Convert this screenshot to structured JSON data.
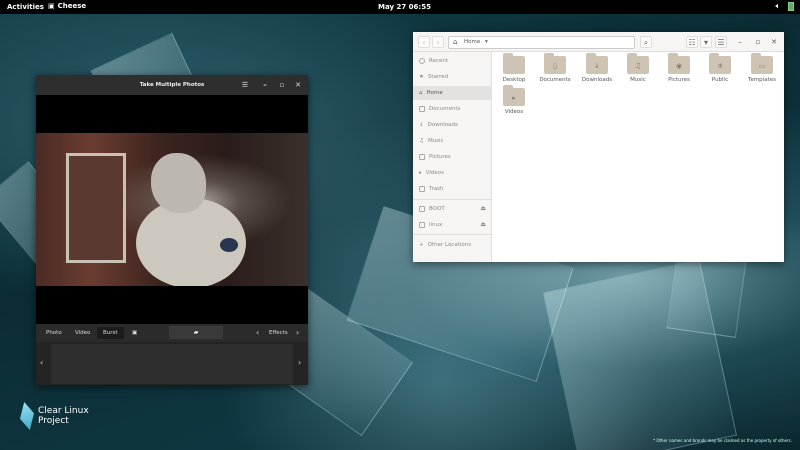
{
  "topbar": {
    "activities": "Activities",
    "app_name": "Cheese",
    "clock": "May 27  06:55"
  },
  "cheese": {
    "title": "Take Multiple Photos",
    "modes": [
      "Photo",
      "Video",
      "Burst"
    ],
    "active_mode": "Burst",
    "effects_label": "Effects"
  },
  "files": {
    "path": "Home",
    "sidebar": [
      {
        "label": "Recent",
        "icon": "clock-icon"
      },
      {
        "label": "Starred",
        "icon": "star-icon"
      },
      {
        "label": "Home",
        "icon": "home-icon",
        "active": true
      },
      {
        "label": "Documents",
        "icon": "document-icon"
      },
      {
        "label": "Downloads",
        "icon": "download-icon"
      },
      {
        "label": "Music",
        "icon": "music-icon"
      },
      {
        "label": "Pictures",
        "icon": "picture-icon"
      },
      {
        "label": "Videos",
        "icon": "video-icon"
      },
      {
        "label": "Trash",
        "icon": "trash-icon"
      }
    ],
    "devices": [
      {
        "label": "BOOT",
        "icon": "drive-icon"
      },
      {
        "label": "linux",
        "icon": "drive-icon"
      }
    ],
    "other_locations": "Other Locations",
    "folders": [
      {
        "label": "Desktop",
        "glyph": ""
      },
      {
        "label": "Documents",
        "glyph": "▯"
      },
      {
        "label": "Downloads",
        "glyph": "↓"
      },
      {
        "label": "Music",
        "glyph": "♫"
      },
      {
        "label": "Pictures",
        "glyph": "◉"
      },
      {
        "label": "Public",
        "glyph": "⋔"
      },
      {
        "label": "Templates",
        "glyph": "▭"
      },
      {
        "label": "Videos",
        "glyph": "▸"
      }
    ]
  },
  "desktop": {
    "logo_line1": "Clear Linux",
    "logo_line2": "Project",
    "disclaimer": "* Other names and brands may be claimed as the property of others."
  }
}
